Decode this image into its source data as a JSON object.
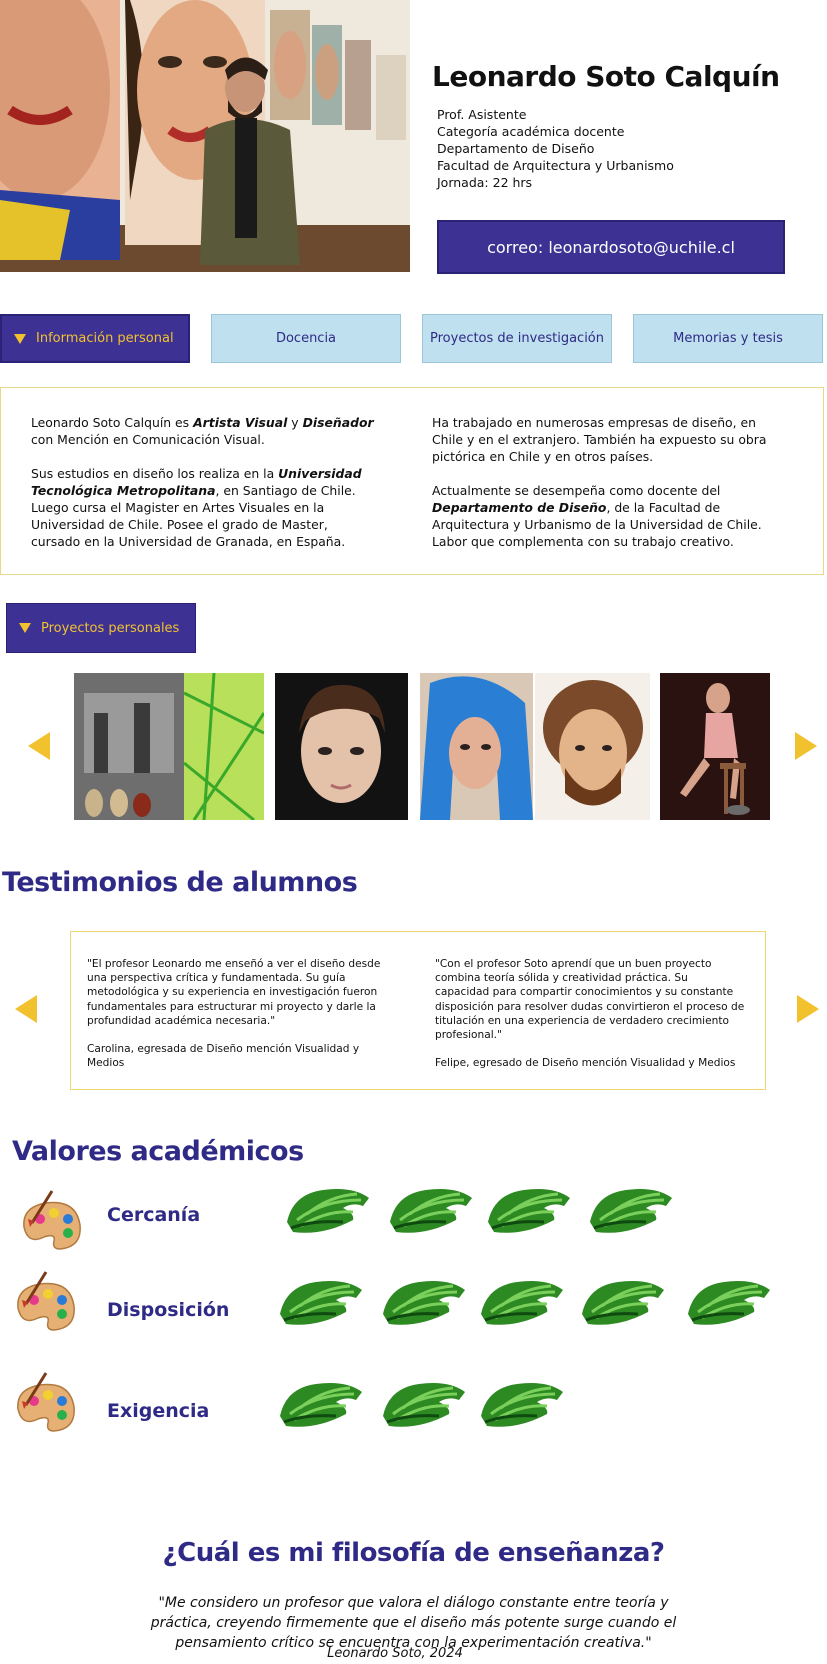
{
  "header": {
    "name": "Leonardo Soto Calquín",
    "roles": [
      "Prof. Asistente",
      "Categoría académica docente",
      "Departamento de Diseño",
      "Facultad de Arquitectura y Urbanismo",
      "Jornada: 22 hrs"
    ],
    "email_button": "correo: leonardosoto@uchile.cl"
  },
  "tabs": [
    {
      "label": "Información personal",
      "active": true
    },
    {
      "label": "Docencia",
      "active": false
    },
    {
      "label": "Proyectos de investigación",
      "active": false
    },
    {
      "label": "Memorias y tesis",
      "active": false
    }
  ],
  "info": {
    "col1_p1_a": "Leonardo Soto Calquín es ",
    "col1_p1_b": "Artista Visual",
    "col1_p1_c": " y ",
    "col1_p1_d": "Diseñador",
    "col1_p1_e": " con Mención en Comunicación Visual.",
    "col1_p2_a": "Sus estudios en diseño los realiza en la ",
    "col1_p2_b": "Universidad Tecnológica Metropolitana",
    "col1_p2_c": ", en Santiago de Chile. Luego cursa el Magister en Artes Visuales en la Universidad de Chile. Posee el grado de Master, cursado en la Universidad de Granada, en España.",
    "col2_p1": "Ha trabajado en numerosas empresas de diseño, en Chile y en el extranjero. También ha expuesto su obra pictórica en Chile y en otros países.",
    "col2_p2_a": "Actualmente se desempeña como docente del ",
    "col2_p2_b": "Departamento de Diseño",
    "col2_p2_c": ", de la Facultad de Arquitectura y Urbanismo de la Universidad de Chile. Labor que complementa con su trabajo creativo."
  },
  "personal_projects": {
    "button": "Proyectos personales"
  },
  "testimonials": {
    "title": "Testimonios de alumnos",
    "items": [
      {
        "quote": "\"El profesor Leonardo me enseñó a ver el diseño desde una perspectiva crítica y fundamentada. Su guía metodológica y su experiencia en investigación fueron fundamentales para estructurar mi proyecto y darle la profundidad académica necesaria.\"",
        "author": "Carolina, egresada de Diseño mención Visualidad y Medios"
      },
      {
        "quote": "\"Con el profesor Soto aprendí que un buen proyecto combina teoría sólida y creatividad práctica. Su capacidad para compartir conocimientos y su constante disposición para resolver dudas convirtieron el proceso de titulación en una experiencia de verdadero crecimiento profesional.\"",
        "author": "Felipe, egresado de Diseño mención Visualidad y Medios"
      }
    ]
  },
  "values": {
    "title": "Valores académicos",
    "items": [
      {
        "label": "Cercanía",
        "rating": 4
      },
      {
        "label": "Disposición",
        "rating": 5
      },
      {
        "label": "Exigencia",
        "rating": 3
      }
    ]
  },
  "philosophy": {
    "title": "¿Cuál es mi filosofía de enseñanza?",
    "quote": "\"Me considero un profesor que valora el diálogo constante entre teoría y práctica, creyendo firmemente que el diseño más potente surge cuando el pensamiento crítico se encuentra con la experimentación creativa.\"",
    "signature": "Leonardo Soto, 2024"
  }
}
